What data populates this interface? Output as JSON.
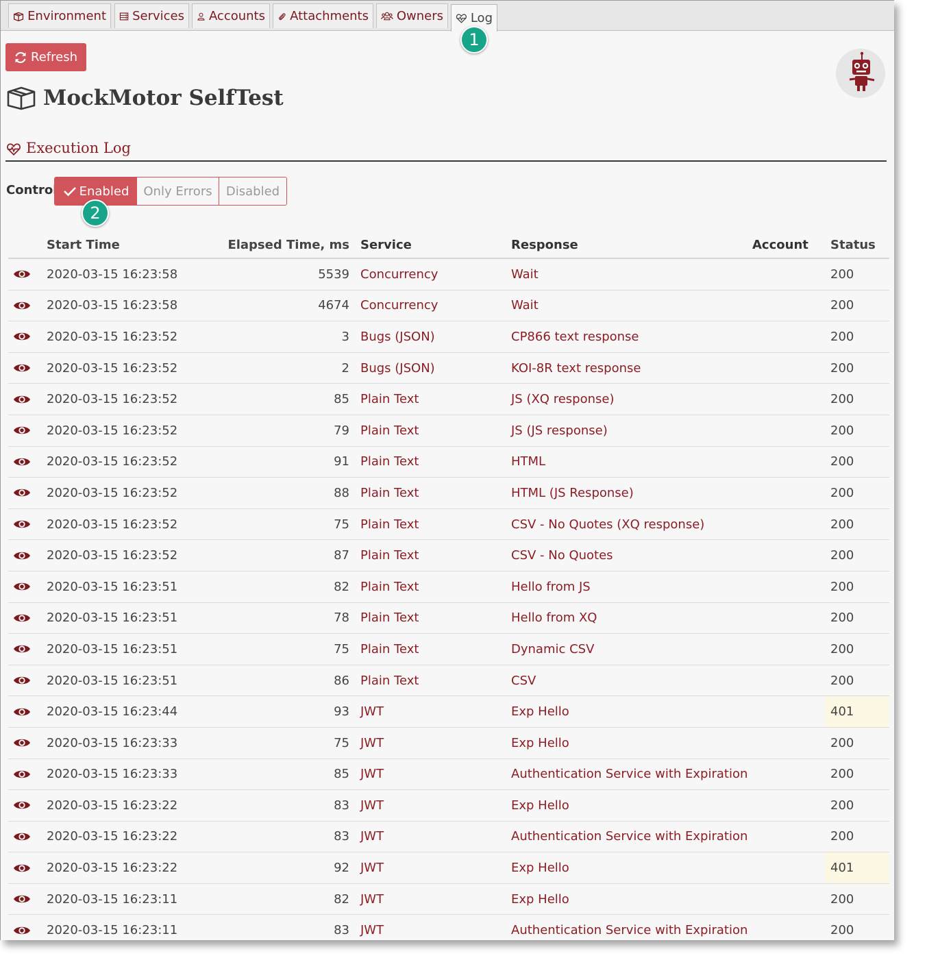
{
  "tabs": [
    {
      "label": "Environment",
      "icon": "box-icon"
    },
    {
      "label": "Services",
      "icon": "server-icon"
    },
    {
      "label": "Accounts",
      "icon": "user-icon"
    },
    {
      "label": "Attachments",
      "icon": "paperclip-icon"
    },
    {
      "label": "Owners",
      "icon": "users-icon"
    },
    {
      "label": "Log",
      "icon": "heartbeat-icon",
      "active": true
    }
  ],
  "callouts": [
    "1",
    "2"
  ],
  "toolbar": {
    "refresh_label": "Refresh"
  },
  "page_title": "MockMotor SelfTest",
  "section_title": "Execution Log",
  "control": {
    "label": "Control",
    "options": [
      "Enabled",
      "Only Errors",
      "Disabled"
    ],
    "selected": "Enabled"
  },
  "table": {
    "columns": [
      "Start Time",
      "Elapsed Time, ms",
      "Service",
      "Response",
      "Account",
      "Status"
    ],
    "rows": [
      {
        "time": "2020-03-15 16:23:58",
        "elapsed": "5539",
        "service": "Concurrency",
        "response": "Wait",
        "account": "",
        "status": "200"
      },
      {
        "time": "2020-03-15 16:23:58",
        "elapsed": "4674",
        "service": "Concurrency",
        "response": "Wait",
        "account": "",
        "status": "200"
      },
      {
        "time": "2020-03-15 16:23:52",
        "elapsed": "3",
        "service": "Bugs (JSON)",
        "response": "CP866 text response",
        "account": "",
        "status": "200"
      },
      {
        "time": "2020-03-15 16:23:52",
        "elapsed": "2",
        "service": "Bugs (JSON)",
        "response": "KOI-8R text response",
        "account": "",
        "status": "200"
      },
      {
        "time": "2020-03-15 16:23:52",
        "elapsed": "85",
        "service": "Plain Text",
        "response": "JS (XQ response)",
        "account": "",
        "status": "200"
      },
      {
        "time": "2020-03-15 16:23:52",
        "elapsed": "79",
        "service": "Plain Text",
        "response": "JS (JS response)",
        "account": "",
        "status": "200"
      },
      {
        "time": "2020-03-15 16:23:52",
        "elapsed": "91",
        "service": "Plain Text",
        "response": "HTML",
        "account": "",
        "status": "200"
      },
      {
        "time": "2020-03-15 16:23:52",
        "elapsed": "88",
        "service": "Plain Text",
        "response": "HTML (JS Response)",
        "account": "",
        "status": "200"
      },
      {
        "time": "2020-03-15 16:23:52",
        "elapsed": "75",
        "service": "Plain Text",
        "response": "CSV - No Quotes (XQ response)",
        "account": "",
        "status": "200"
      },
      {
        "time": "2020-03-15 16:23:52",
        "elapsed": "87",
        "service": "Plain Text",
        "response": "CSV - No Quotes",
        "account": "",
        "status": "200"
      },
      {
        "time": "2020-03-15 16:23:51",
        "elapsed": "82",
        "service": "Plain Text",
        "response": "Hello from JS",
        "account": "",
        "status": "200"
      },
      {
        "time": "2020-03-15 16:23:51",
        "elapsed": "78",
        "service": "Plain Text",
        "response": "Hello from XQ",
        "account": "",
        "status": "200"
      },
      {
        "time": "2020-03-15 16:23:51",
        "elapsed": "75",
        "service": "Plain Text",
        "response": "Dynamic CSV",
        "account": "",
        "status": "200"
      },
      {
        "time": "2020-03-15 16:23:51",
        "elapsed": "86",
        "service": "Plain Text",
        "response": "CSV",
        "account": "",
        "status": "200"
      },
      {
        "time": "2020-03-15 16:23:44",
        "elapsed": "93",
        "service": "JWT",
        "response": "Exp Hello",
        "account": "",
        "status": "401",
        "warn": true
      },
      {
        "time": "2020-03-15 16:23:33",
        "elapsed": "75",
        "service": "JWT",
        "response": "Exp Hello",
        "account": "",
        "status": "200"
      },
      {
        "time": "2020-03-15 16:23:33",
        "elapsed": "85",
        "service": "JWT",
        "response": "Authentication Service with Expiration",
        "account": "",
        "status": "200"
      },
      {
        "time": "2020-03-15 16:23:22",
        "elapsed": "83",
        "service": "JWT",
        "response": "Exp Hello",
        "account": "",
        "status": "200"
      },
      {
        "time": "2020-03-15 16:23:22",
        "elapsed": "83",
        "service": "JWT",
        "response": "Authentication Service with Expiration",
        "account": "",
        "status": "200"
      },
      {
        "time": "2020-03-15 16:23:22",
        "elapsed": "92",
        "service": "JWT",
        "response": "Exp Hello",
        "account": "",
        "status": "401",
        "warn": true
      },
      {
        "time": "2020-03-15 16:23:11",
        "elapsed": "82",
        "service": "JWT",
        "response": "Exp Hello",
        "account": "",
        "status": "200"
      },
      {
        "time": "2020-03-15 16:23:11",
        "elapsed": "83",
        "service": "JWT",
        "response": "Authentication Service with Expiration",
        "account": "",
        "status": "200"
      }
    ]
  },
  "colors": {
    "accent": "#d1545b",
    "link": "#8b1e24",
    "callout": "#17a589",
    "warn_bg": "#fcf8e3"
  }
}
